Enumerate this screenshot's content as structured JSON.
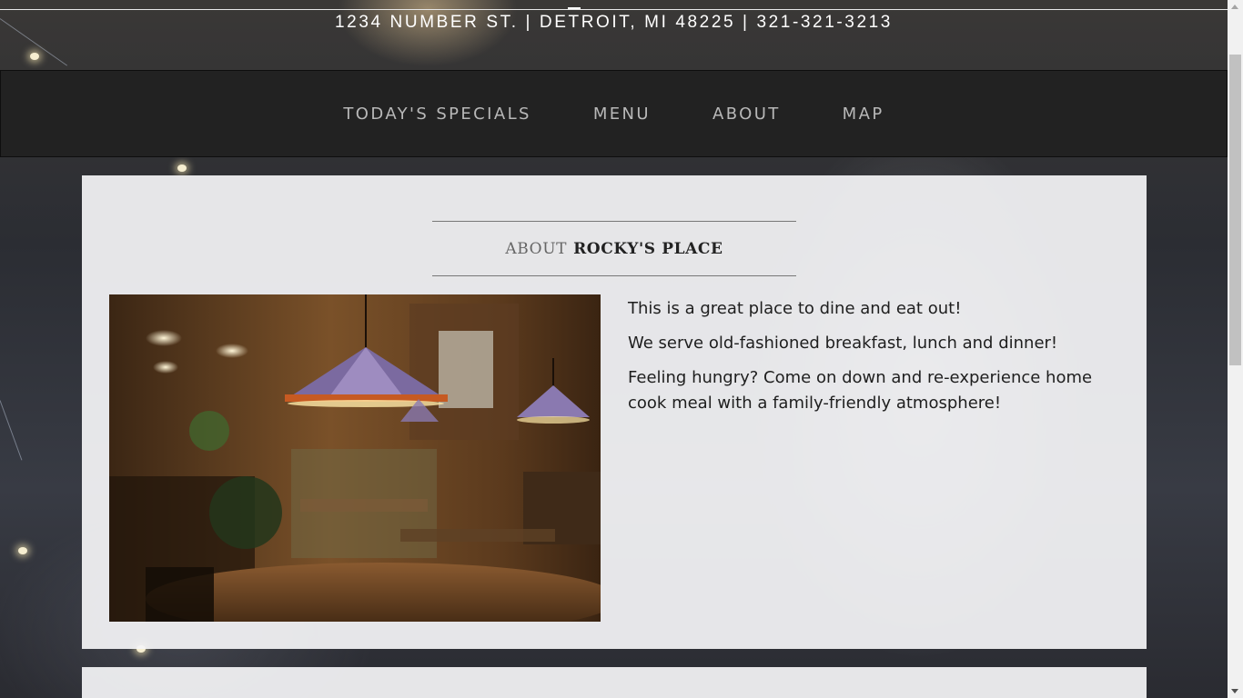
{
  "header": {
    "address": "1234 NUMBER ST. | DETROIT, MI 48225 | 321-321-3213"
  },
  "nav": {
    "items": [
      "TODAY'S SPECIALS",
      "MENU",
      "ABOUT",
      "MAP"
    ]
  },
  "about": {
    "heading_prefix": "ABOUT",
    "heading_name": "ROCKY'S PLACE",
    "image_alt": "Restaurant interior with stained glass lamps",
    "paragraphs": [
      "This is a great place to dine and eat out!",
      "We serve old-fashioned breakfast, lunch and dinner!",
      "Feeling hungry? Come on down and re-experience home cook meal with a family-friendly atmosphere!"
    ]
  },
  "colors": {
    "navbar_bg": "#222222",
    "nav_text": "#b8b8b8",
    "panel_bg": "#f4f4f6",
    "body_text": "#1e1e1e"
  }
}
